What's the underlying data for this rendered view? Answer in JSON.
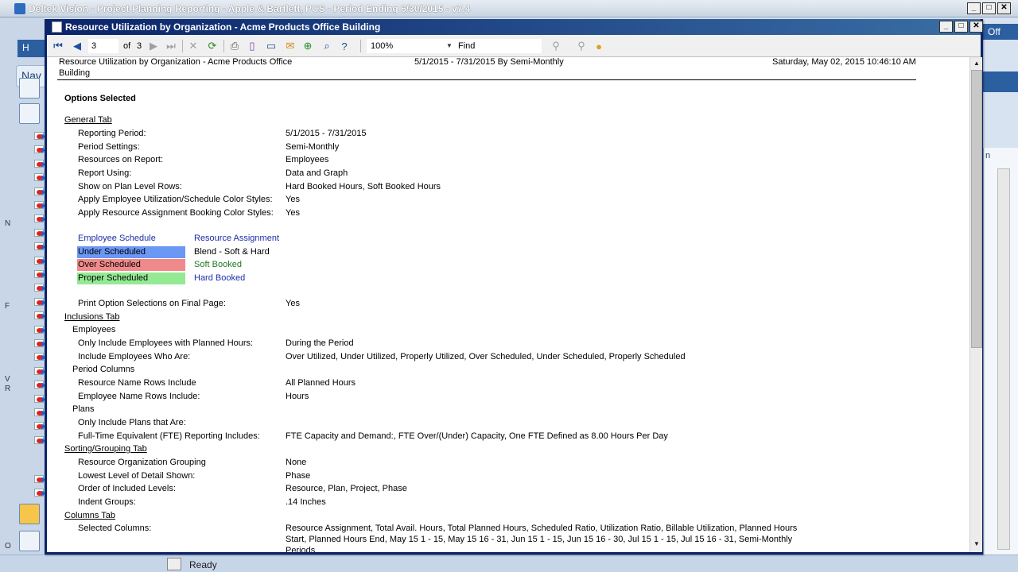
{
  "app": {
    "title": "Deltek Vision - Project Planning Reporting - Apple & Bartlett, PCS - Period Ending 6/30/2015 - v7.4",
    "left_tab_label": "H",
    "nav_label": "Nav",
    "right_tab_label": "Off",
    "right_fragment": "n",
    "status": "Ready",
    "edge_chars": [
      "N",
      "F",
      "V",
      "R",
      "O"
    ]
  },
  "report_window": {
    "title": "Resource Utilization by Organization - Acme Products Office Building",
    "toolbar": {
      "page_current": "3",
      "of_label": "of",
      "page_total": "3",
      "zoom": "100%",
      "find_label": "Find"
    }
  },
  "report": {
    "header_title_line1": "Resource Utilization by Organization - Acme Products Office",
    "header_title_line2": "Building",
    "header_period": "5/1/2015 - 7/31/2015 By Semi-Monthly",
    "header_timestamp": "Saturday, May 02, 2015 10:46:10 AM",
    "options_heading": "Options Selected",
    "general_tab": {
      "heading": "General Tab",
      "rows": [
        {
          "label": "Reporting Period:",
          "value": "5/1/2015 - 7/31/2015"
        },
        {
          "label": "Period Settings:",
          "value": "Semi-Monthly"
        },
        {
          "label": "Resources on Report:",
          "value": "Employees"
        },
        {
          "label": "Report Using:",
          "value": "Data and Graph"
        },
        {
          "label": "Show on Plan Level Rows:",
          "value": "Hard Booked Hours, Soft Booked Hours"
        },
        {
          "label": "Apply Employee Utilization/Schedule Color Styles:",
          "value": "Yes"
        },
        {
          "label": "Apply Resource Assignment Booking Color Styles:",
          "value": "Yes"
        }
      ]
    },
    "legend": {
      "employee_schedule_header": "Employee Schedule",
      "resource_assignment_header": "Resource Assignment",
      "employee_items": [
        {
          "label": "Under Scheduled",
          "color": "#6b97f5"
        },
        {
          "label": "Over Scheduled",
          "color": "#f08a8a"
        },
        {
          "label": "Proper Scheduled",
          "color": "#93ea93"
        }
      ],
      "assignment_items": [
        {
          "label": "Blend - Soft & Hard",
          "color": "#000000"
        },
        {
          "label": "Soft Booked",
          "color": "#1f7a1f"
        },
        {
          "label": "Hard Booked",
          "color": "#1c2ea8"
        }
      ]
    },
    "print_option": {
      "label": "Print Option Selections on Final Page:",
      "value": "Yes"
    },
    "inclusions_tab": {
      "heading": "Inclusions Tab",
      "employees_heading": "Employees",
      "employee_rows": [
        {
          "label": "Only Include Employees with Planned Hours:",
          "value": "During the Period"
        },
        {
          "label": "Include Employees Who Are:",
          "value": "Over Utilized, Under Utilized, Properly Utilized, Over Scheduled, Under Scheduled, Properly Scheduled"
        }
      ],
      "period_columns_heading": "Period Columns",
      "period_rows": [
        {
          "label": "Resource Name Rows Include",
          "value": "All Planned Hours"
        },
        {
          "label": "Employee Name Rows Include:",
          "value": "Hours"
        }
      ],
      "plans_heading": "Plans",
      "plan_rows": [
        {
          "label": "Only Include Plans that Are:",
          "value": ""
        },
        {
          "label": "Full-Time Equivalent (FTE) Reporting Includes:",
          "value": "FTE Capacity and Demand:, FTE Over/(Under) Capacity, One FTE Defined as 8.00 Hours Per Day"
        }
      ]
    },
    "sorting_tab": {
      "heading": "Sorting/Grouping Tab",
      "rows": [
        {
          "label": "Resource Organization Grouping",
          "value": "None"
        },
        {
          "label": "Lowest Level of Detail Shown:",
          "value": "Phase"
        },
        {
          "label": "Order of Included Levels:",
          "value": "Resource, Plan, Project, Phase"
        },
        {
          "label": "Indent Groups:",
          "value": ".14 Inches"
        }
      ]
    },
    "columns_tab": {
      "heading": "Columns Tab",
      "selected_label": "Selected Columns:",
      "selected_line1": "Resource Assignment, Total Avail. Hours, Total Planned Hours, Scheduled Ratio, Utilization Ratio, Billable Utilization, Planned Hours",
      "selected_line2": "Start, Planned Hours End, May 15 1 - 15, May 15 16 - 31, Jun 15 1 - 15, Jun 15 16 - 30, Jul 15 1 - 15, Jul 15 16 - 31, Semi-Monthly",
      "selected_line3": "Periods"
    }
  }
}
